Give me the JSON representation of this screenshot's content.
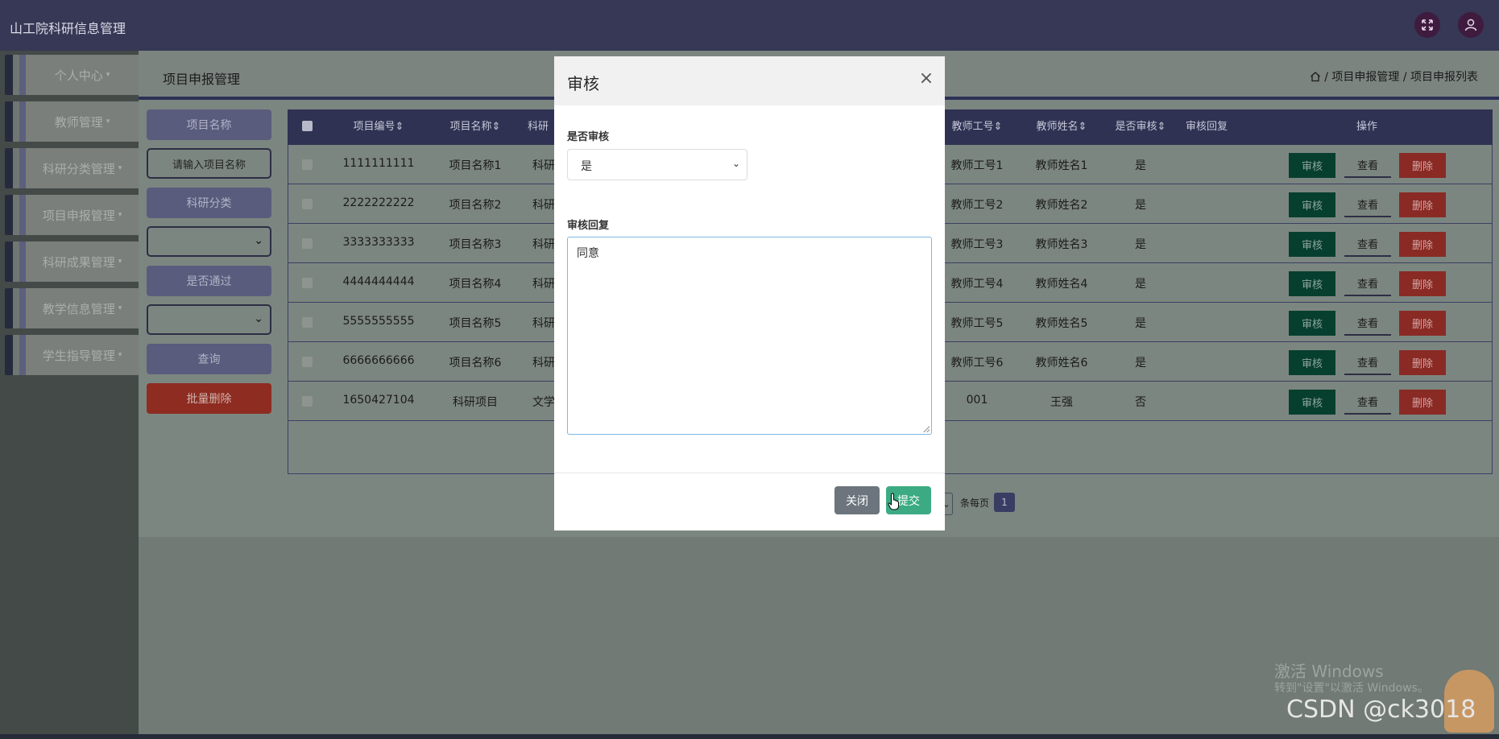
{
  "app": {
    "title": "山工院科研信息管理"
  },
  "topbar_icons": [
    "fullscreen-icon",
    "user-icon"
  ],
  "sidebar": {
    "items": [
      {
        "label": "个人中心"
      },
      {
        "label": "教师管理"
      },
      {
        "label": "科研分类管理"
      },
      {
        "label": "项目申报管理"
      },
      {
        "label": "科研成果管理"
      },
      {
        "label": "教学信息管理"
      },
      {
        "label": "学生指导管理"
      }
    ]
  },
  "header": {
    "title": "项目申报管理",
    "breadcrumb": "项目申报管理 / 项目申报列表"
  },
  "filters": {
    "project_name_label": "项目名称",
    "project_name_placeholder": "请输入项目名称",
    "category_label": "科研分类",
    "passed_label": "是否通过",
    "query_button": "查询",
    "bulk_delete_button": "批量删除"
  },
  "table": {
    "columns": [
      "项目编号",
      "项目名称",
      "科研",
      "教师工号",
      "教师姓名",
      "是否审核",
      "审核回复",
      "操作"
    ],
    "rows": [
      {
        "code": "1111111111",
        "name": "项目名称1",
        "cat": "科研",
        "teacher_no": "教师工号1",
        "teacher_name": "教师姓名1",
        "audited": "是"
      },
      {
        "code": "2222222222",
        "name": "项目名称2",
        "cat": "科研",
        "teacher_no": "教师工号2",
        "teacher_name": "教师姓名2",
        "audited": "是"
      },
      {
        "code": "3333333333",
        "name": "项目名称3",
        "cat": "科研",
        "teacher_no": "教师工号3",
        "teacher_name": "教师姓名3",
        "audited": "是"
      },
      {
        "code": "4444444444",
        "name": "项目名称4",
        "cat": "科研",
        "teacher_no": "教师工号4",
        "teacher_name": "教师姓名4",
        "audited": "是"
      },
      {
        "code": "5555555555",
        "name": "项目名称5",
        "cat": "科研",
        "teacher_no": "教师工号5",
        "teacher_name": "教师姓名5",
        "audited": "是"
      },
      {
        "code": "6666666666",
        "name": "项目名称6",
        "cat": "科研",
        "teacher_no": "教师工号6",
        "teacher_name": "教师姓名6",
        "audited": "是"
      },
      {
        "code": "1650427104",
        "name": "科研项目",
        "cat": "文学",
        "teacher_no": "001",
        "teacher_name": "王强",
        "audited": "否"
      }
    ],
    "actions": {
      "audit": "审核",
      "view": "查看",
      "delete": "删除"
    }
  },
  "pager": {
    "per_page_text": "条每页",
    "current_page": "1"
  },
  "modal": {
    "title": "审核",
    "audit_label": "是否审核",
    "audit_value": "是",
    "reply_label": "审核回复",
    "reply_value": "同意",
    "close_button": "关闭",
    "submit_button": "提交"
  },
  "watermark": {
    "line1": "激活 Windows",
    "line2": "转到\"设置\"以激活 Windows。",
    "csdn": "CSDN @ck3018"
  },
  "colors": {
    "topbar": "#363855",
    "table_header": "#2f3252",
    "audit_button": "#073f2f",
    "delete_button": "#8a2a25",
    "submit_button": "#3cab83",
    "close_button": "#6c757d"
  }
}
